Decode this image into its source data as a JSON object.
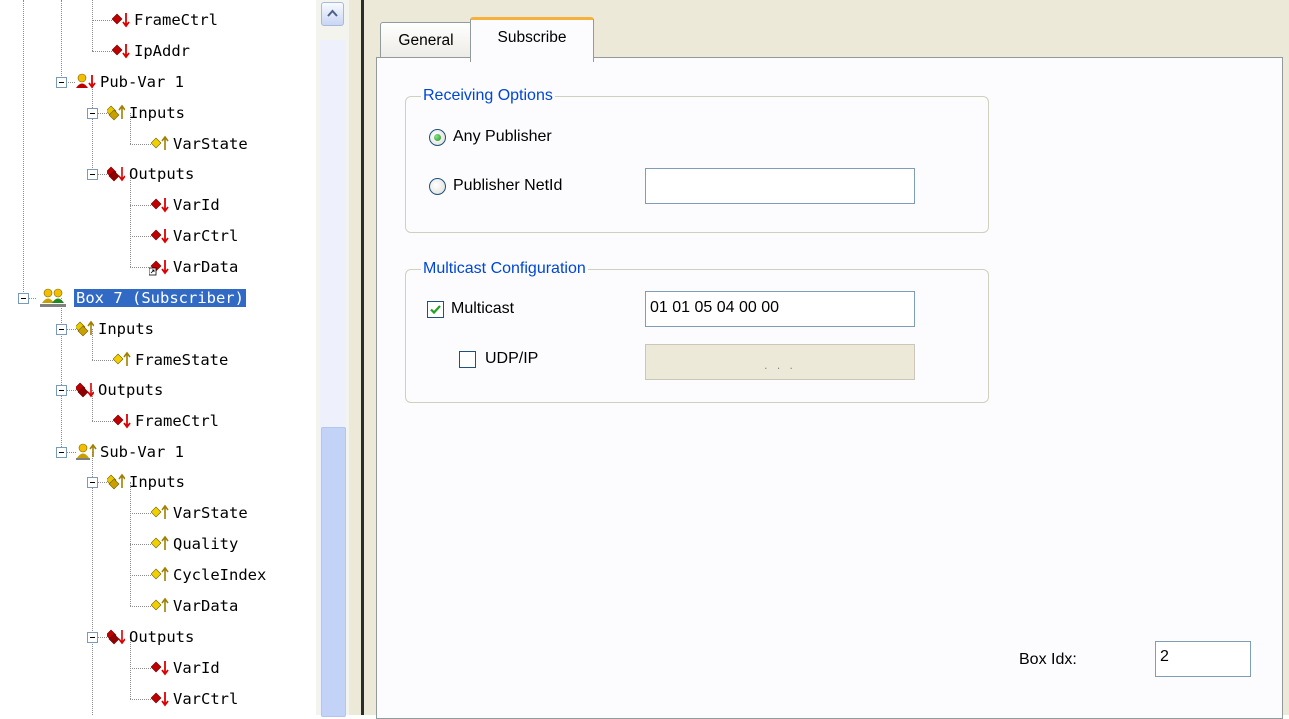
{
  "tree": {
    "items": [
      {
        "label": "FrameCtrl",
        "icon": "output-var-icon"
      },
      {
        "label": "IpAddr",
        "icon": "output-var-icon"
      },
      {
        "label": "Pub-Var 1",
        "icon": "publisher-var-icon"
      },
      {
        "label": "Inputs",
        "icon": "inputs-folder-icon"
      },
      {
        "label": "VarState",
        "icon": "input-var-icon"
      },
      {
        "label": "Outputs",
        "icon": "outputs-folder-icon"
      },
      {
        "label": "VarId",
        "icon": "output-var-icon"
      },
      {
        "label": "VarCtrl",
        "icon": "output-var-icon"
      },
      {
        "label": "VarData",
        "icon": "output-var-linked-icon"
      },
      {
        "label": "Box 7 (Subscriber)",
        "icon": "subscriber-box-icon"
      },
      {
        "label": "Inputs",
        "icon": "inputs-folder-icon"
      },
      {
        "label": "FrameState",
        "icon": "input-var-icon"
      },
      {
        "label": "Outputs",
        "icon": "outputs-folder-icon"
      },
      {
        "label": "FrameCtrl",
        "icon": "output-var-icon"
      },
      {
        "label": "Sub-Var 1",
        "icon": "subscriber-var-icon"
      },
      {
        "label": "Inputs",
        "icon": "inputs-folder-icon"
      },
      {
        "label": "VarState",
        "icon": "input-var-icon"
      },
      {
        "label": "Quality",
        "icon": "input-var-icon"
      },
      {
        "label": "CycleIndex",
        "icon": "input-var-icon"
      },
      {
        "label": "VarData",
        "icon": "input-var-icon"
      },
      {
        "label": "Outputs",
        "icon": "outputs-folder-icon"
      },
      {
        "label": "VarId",
        "icon": "output-var-icon"
      },
      {
        "label": "VarCtrl",
        "icon": "output-var-icon"
      }
    ],
    "selected": "Box 7 (Subscriber)"
  },
  "tabs": [
    "General",
    "Subscribe"
  ],
  "active_tab": "Subscribe",
  "receiving": {
    "title": "Receiving Options",
    "any_publisher_label": "Any Publisher",
    "any_publisher_selected": true,
    "publisher_netid_label": "Publisher NetId",
    "publisher_netid_value": ""
  },
  "multicast": {
    "title": "Multicast Configuration",
    "multicast_label": "Multicast",
    "multicast_checked": true,
    "multicast_value": "01 01 05 04 00 00",
    "udp_label": "UDP/IP",
    "udp_checked": false,
    "udp_value": ". . ."
  },
  "box_idx": {
    "label": "Box Idx:",
    "value": "2"
  },
  "colors": {
    "selection": "#316ac5",
    "group_title": "#0046d5",
    "tab_highlight": "#f7b03a",
    "dialog_bg": "#ece9d8"
  }
}
